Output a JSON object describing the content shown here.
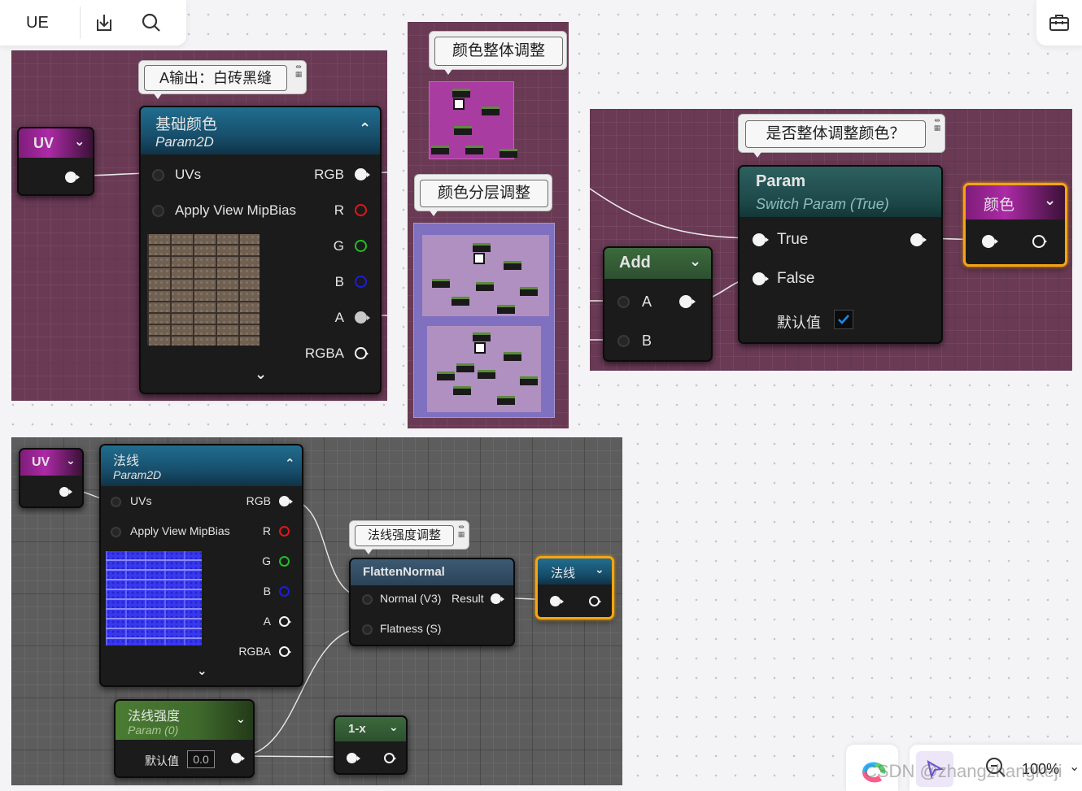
{
  "toolbar": {
    "brand": "UE"
  },
  "graph1": {
    "comment": "A输出：白砖黑缝",
    "uv_node": {
      "title": "UV"
    },
    "texture_node": {
      "title": "基础颜色",
      "subtitle": "Param2D",
      "inputs": [
        "UVs",
        "Apply View MipBias"
      ],
      "outputs": [
        "RGB",
        "R",
        "G",
        "B",
        "A",
        "RGBA"
      ]
    }
  },
  "graph2": {
    "comment_top": "颜色整体调整",
    "comment_bottom": "颜色分层调整"
  },
  "graph3": {
    "comment": "是否整体调整颜色？",
    "add_node": {
      "title": "Add",
      "inputs": [
        "A",
        "B"
      ]
    },
    "param_node": {
      "title": "Param",
      "subtitle": "Switch Param (True)",
      "inputs": [
        "True",
        "False"
      ],
      "default_label": "默认值",
      "default_checked": true
    },
    "output_node": {
      "title": "颜色"
    }
  },
  "graph4": {
    "uv_node": {
      "title": "UV"
    },
    "texture_node": {
      "title": "法线",
      "subtitle": "Param2D",
      "inputs": [
        "UVs",
        "Apply View MipBias"
      ],
      "outputs": [
        "RGB",
        "R",
        "G",
        "B",
        "A",
        "RGBA"
      ]
    },
    "comment": "法线强度调整",
    "flatten_node": {
      "title": "FlattenNormal",
      "inputs": [
        "Normal (V3)",
        "Flatness (S)"
      ],
      "output": "Result"
    },
    "output_node": {
      "title": "法线"
    },
    "strength_node": {
      "title": "法线强度",
      "subtitle": "Param (0)",
      "default_label": "默认值",
      "default_value": "0.0"
    },
    "oneminus_node": {
      "title": "1-x"
    }
  },
  "footer": {
    "zoom": "100%",
    "watermark": "CSDN @zhangzhangkeji"
  },
  "colors": {
    "frame_purple": "#6a3a55",
    "frame_gray": "#5d5d5d",
    "selected_outline": "#f5a513",
    "checkbox": "#1e88e5"
  }
}
